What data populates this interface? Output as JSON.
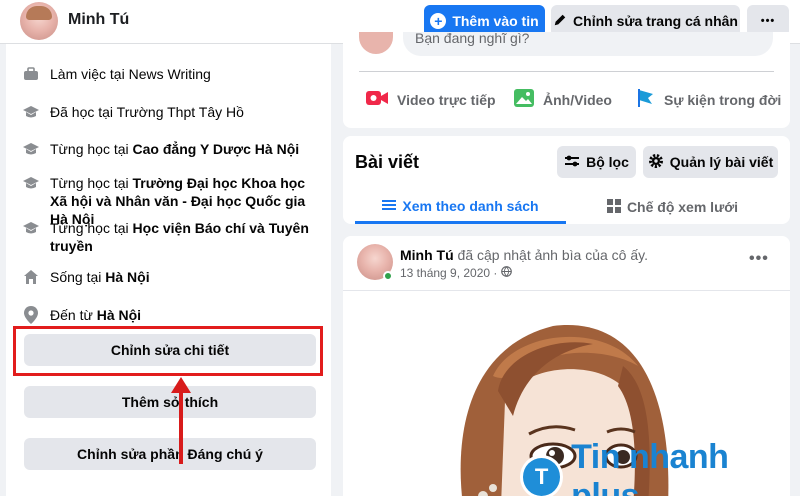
{
  "header": {
    "name": "Minh Tú",
    "add_story_label": "Thêm vào tin",
    "edit_profile_label": "Chỉnh sửa trang cá nhân",
    "more_label": "•••"
  },
  "intro": {
    "items": [
      {
        "icon": "briefcase-icon",
        "prefix": "Làm việc tại ",
        "bold": "",
        "suffix": "News Writing"
      },
      {
        "icon": "graduation-cap-icon",
        "prefix": "Đã học tại ",
        "bold": "",
        "suffix": "Trường Thpt Tây Hồ"
      },
      {
        "icon": "graduation-cap-icon",
        "prefix": "Từng học tại ",
        "bold": "Cao đẳng Y Dược Hà Nội",
        "suffix": ""
      },
      {
        "icon": "graduation-cap-icon",
        "prefix": "Từng học tại ",
        "bold": "Trường Đại học Khoa học Xã hội và Nhân văn - Đại học Quốc gia Hà Nội",
        "suffix": ""
      },
      {
        "icon": "graduation-cap-icon",
        "prefix": "Từng học tại ",
        "bold": "Học viện Báo chí và Tuyên truyền",
        "suffix": ""
      },
      {
        "icon": "home-icon",
        "prefix": "Sống tại ",
        "bold": "Hà Nội",
        "suffix": ""
      },
      {
        "icon": "location-pin-icon",
        "prefix": "Đến từ ",
        "bold": "Hà Nội",
        "suffix": ""
      }
    ],
    "edit_details_label": "Chỉnh sửa chi tiết",
    "add_hobbies_label": "Thêm sở thích",
    "edit_featured_label": "Chỉnh sửa phần Đáng chú ý"
  },
  "composer": {
    "placeholder": "Bạn đang nghĩ gì?",
    "actions": [
      {
        "icon": "live-video-icon",
        "label": "Video trực tiếp",
        "color": "#f02849"
      },
      {
        "icon": "photo-video-icon",
        "label": "Ảnh/Video",
        "color": "#45bd62"
      },
      {
        "icon": "life-event-flag-icon",
        "label": "Sự kiện trong đời",
        "color": "#1877f2"
      }
    ]
  },
  "posts": {
    "title": "Bài viết",
    "filter_label": "Bộ lọc",
    "manage_label": "Quản lý bài viết",
    "tab_list_label": "Xem theo danh sách",
    "tab_grid_label": "Chế độ xem lưới"
  },
  "post": {
    "author": "Minh Tú",
    "action_text": " đã cập nhật ảnh bìa của cô ấy.",
    "date": "13 tháng 9, 2020 ·",
    "more": "•••"
  },
  "watermark": {
    "logo_letter": "T",
    "text": "Tin nhanh plus"
  },
  "colors": {
    "accent": "#1877f2",
    "highlight": "#e21c1c"
  }
}
